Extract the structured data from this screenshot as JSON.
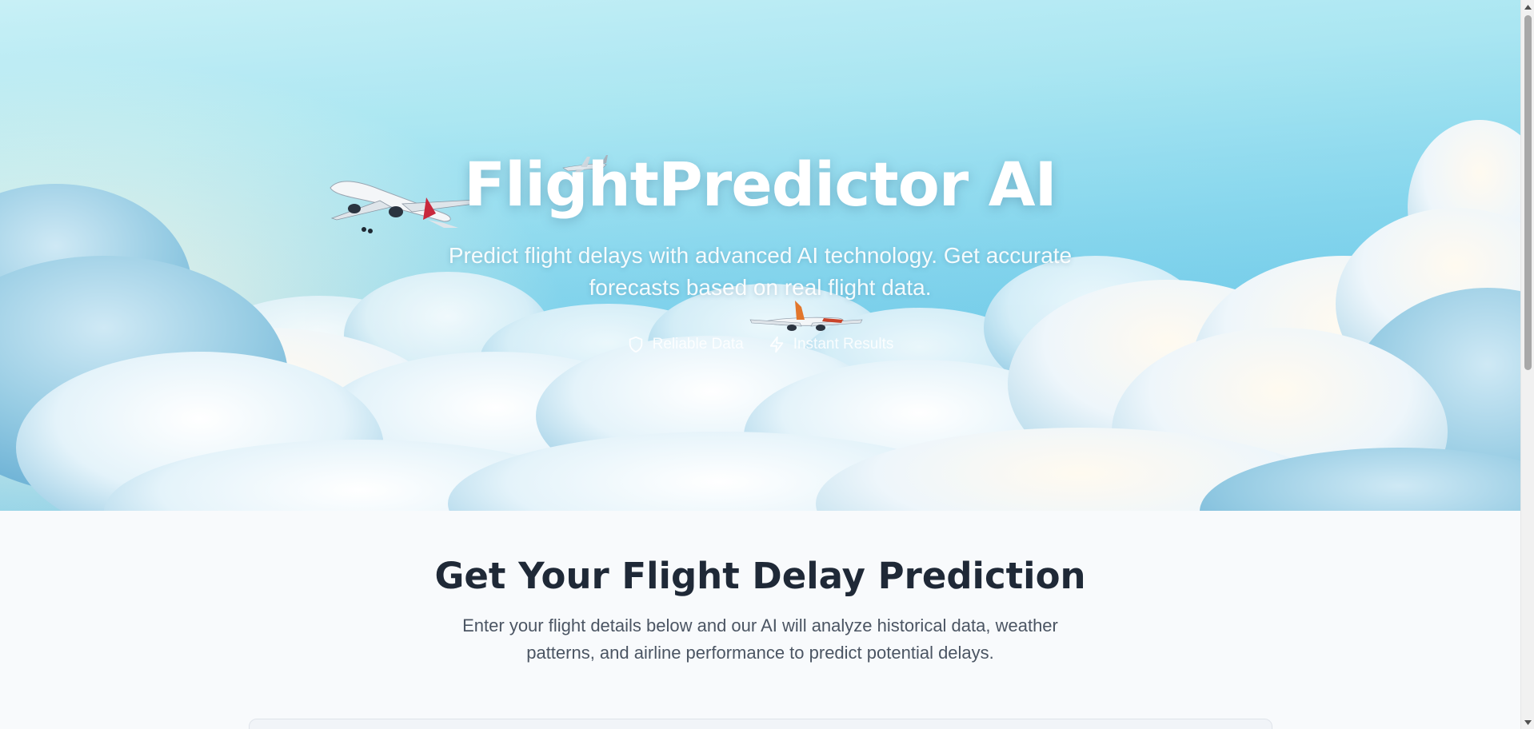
{
  "hero": {
    "title": "FlightPredictor AI",
    "subtitle": "Predict flight delays with advanced AI technology. Get accurate forecasts based on real flight data.",
    "badges": [
      {
        "icon": "shield-icon",
        "label": "Reliable Data"
      },
      {
        "icon": "lightning-icon",
        "label": "Instant Results"
      }
    ]
  },
  "section": {
    "title": "Get Your Flight Delay Prediction",
    "description": "Enter your flight details below and our AI will analyze historical data, weather patterns, and airline performance to predict potential delays."
  },
  "colors": {
    "sky_top": "#c8f0f6",
    "sky_bottom": "#4fb7e2",
    "page_background": "#f8fafc",
    "heading": "#1f2937",
    "body_text": "#4b5563",
    "plane_tail_accent": "#c8283c"
  }
}
